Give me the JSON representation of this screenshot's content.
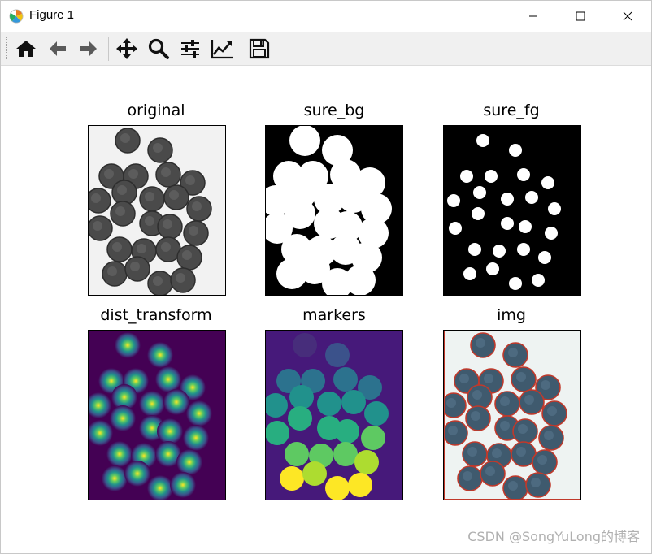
{
  "window": {
    "title": "Figure 1",
    "minimize_icon": "minimize-icon",
    "maximize_icon": "maximize-icon",
    "close_icon": "close-icon"
  },
  "toolbar": {
    "buttons": [
      {
        "name": "home",
        "icon": "home-icon"
      },
      {
        "name": "back",
        "icon": "arrow-left-icon"
      },
      {
        "name": "forward",
        "icon": "arrow-right-icon"
      },
      {
        "name": "pan",
        "icon": "move-icon"
      },
      {
        "name": "zoom",
        "icon": "magnifier-icon"
      },
      {
        "name": "configure-subplots",
        "icon": "sliders-icon"
      },
      {
        "name": "edit-axis",
        "icon": "line-chart-icon"
      },
      {
        "name": "save",
        "icon": "floppy-icon"
      }
    ]
  },
  "subplots": [
    {
      "title": "original"
    },
    {
      "title": "sure_bg"
    },
    {
      "title": "sure_fg"
    },
    {
      "title": "dist_transform"
    },
    {
      "title": "markers"
    },
    {
      "title": "img"
    }
  ],
  "watermark": "CSDN @SongYuLong的博客",
  "colors": {
    "viridis_dark": "#440154",
    "viridis_yellow": "#fde725",
    "coin_gray": "#4a4a4a",
    "coin_outline_red": "#c0392b"
  }
}
